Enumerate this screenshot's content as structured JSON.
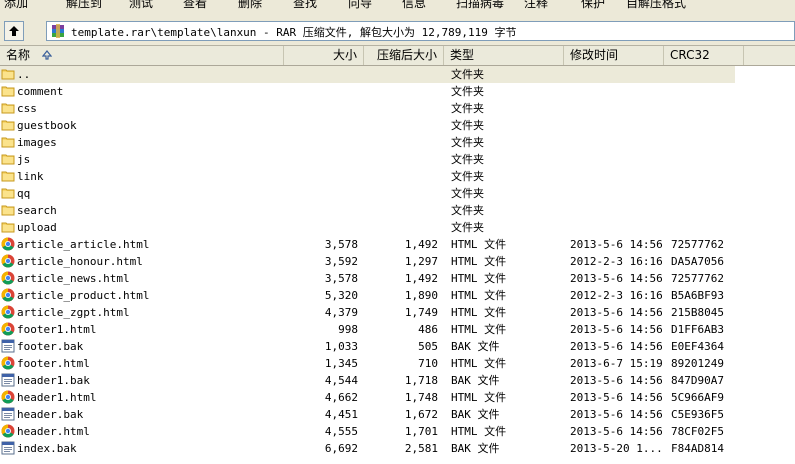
{
  "toolbar": {
    "buttons": [
      "添加",
      "解压到",
      "测试",
      "查看",
      "删除",
      "查找",
      "向导",
      "信息",
      "扫描病毒",
      "注释",
      "保护",
      "自解压格式"
    ]
  },
  "address": {
    "path": "template.rar\\template\\lanxun - RAR 压缩文件, 解包大小为 12,789,119 字节"
  },
  "columns": {
    "name": "名称",
    "size": "大小",
    "packed": "压缩后大小",
    "type": "类型",
    "modified": "修改时间",
    "crc": "CRC32"
  },
  "files": [
    {
      "icon": "folder",
      "name": "..",
      "size": "",
      "packed": "",
      "type": "文件夹",
      "modified": "",
      "crc": ""
    },
    {
      "icon": "folder",
      "name": "comment",
      "size": "",
      "packed": "",
      "type": "文件夹",
      "modified": "",
      "crc": ""
    },
    {
      "icon": "folder",
      "name": "css",
      "size": "",
      "packed": "",
      "type": "文件夹",
      "modified": "",
      "crc": ""
    },
    {
      "icon": "folder",
      "name": "guestbook",
      "size": "",
      "packed": "",
      "type": "文件夹",
      "modified": "",
      "crc": ""
    },
    {
      "icon": "folder",
      "name": "images",
      "size": "",
      "packed": "",
      "type": "文件夹",
      "modified": "",
      "crc": ""
    },
    {
      "icon": "folder",
      "name": "js",
      "size": "",
      "packed": "",
      "type": "文件夹",
      "modified": "",
      "crc": ""
    },
    {
      "icon": "folder",
      "name": "link",
      "size": "",
      "packed": "",
      "type": "文件夹",
      "modified": "",
      "crc": ""
    },
    {
      "icon": "folder",
      "name": "qq",
      "size": "",
      "packed": "",
      "type": "文件夹",
      "modified": "",
      "crc": ""
    },
    {
      "icon": "folder",
      "name": "search",
      "size": "",
      "packed": "",
      "type": "文件夹",
      "modified": "",
      "crc": ""
    },
    {
      "icon": "folder",
      "name": "upload",
      "size": "",
      "packed": "",
      "type": "文件夹",
      "modified": "",
      "crc": ""
    },
    {
      "icon": "chrome",
      "name": "article_article.html",
      "size": "3,578",
      "packed": "1,492",
      "type": "HTML 文件",
      "modified": "2013-5-6 14:56",
      "crc": "72577762"
    },
    {
      "icon": "chrome",
      "name": "article_honour.html",
      "size": "3,592",
      "packed": "1,297",
      "type": "HTML 文件",
      "modified": "2012-2-3 16:16",
      "crc": "DA5A7056"
    },
    {
      "icon": "chrome",
      "name": "article_news.html",
      "size": "3,578",
      "packed": "1,492",
      "type": "HTML 文件",
      "modified": "2013-5-6 14:56",
      "crc": "72577762"
    },
    {
      "icon": "chrome",
      "name": "article_product.html",
      "size": "5,320",
      "packed": "1,890",
      "type": "HTML 文件",
      "modified": "2012-2-3 16:16",
      "crc": "B5A6BF93"
    },
    {
      "icon": "chrome",
      "name": "article_zgpt.html",
      "size": "4,379",
      "packed": "1,749",
      "type": "HTML 文件",
      "modified": "2013-5-6 14:56",
      "crc": "215B8045"
    },
    {
      "icon": "chrome",
      "name": "footer1.html",
      "size": "998",
      "packed": "486",
      "type": "HTML 文件",
      "modified": "2013-5-6 14:56",
      "crc": "D1FF6AB3"
    },
    {
      "icon": "bak",
      "name": "footer.bak",
      "size": "1,033",
      "packed": "505",
      "type": "BAK 文件",
      "modified": "2013-5-6 14:56",
      "crc": "E0EF4364"
    },
    {
      "icon": "chrome",
      "name": "footer.html",
      "size": "1,345",
      "packed": "710",
      "type": "HTML 文件",
      "modified": "2013-6-7 15:19",
      "crc": "89201249"
    },
    {
      "icon": "bak",
      "name": "header1.bak",
      "size": "4,544",
      "packed": "1,718",
      "type": "BAK 文件",
      "modified": "2013-5-6 14:56",
      "crc": "847D90A7"
    },
    {
      "icon": "chrome",
      "name": "header1.html",
      "size": "4,662",
      "packed": "1,748",
      "type": "HTML 文件",
      "modified": "2013-5-6 14:56",
      "crc": "5C966AF9"
    },
    {
      "icon": "bak",
      "name": "header.bak",
      "size": "4,451",
      "packed": "1,672",
      "type": "BAK 文件",
      "modified": "2013-5-6 14:56",
      "crc": "C5E936F5"
    },
    {
      "icon": "chrome",
      "name": "header.html",
      "size": "4,555",
      "packed": "1,701",
      "type": "HTML 文件",
      "modified": "2013-5-6 14:56",
      "crc": "78CF02F5"
    },
    {
      "icon": "bak",
      "name": "index.bak",
      "size": "6,692",
      "packed": "2,581",
      "type": "BAK 文件",
      "modified": "2013-5-20 1...",
      "crc": "F84AD814"
    }
  ]
}
